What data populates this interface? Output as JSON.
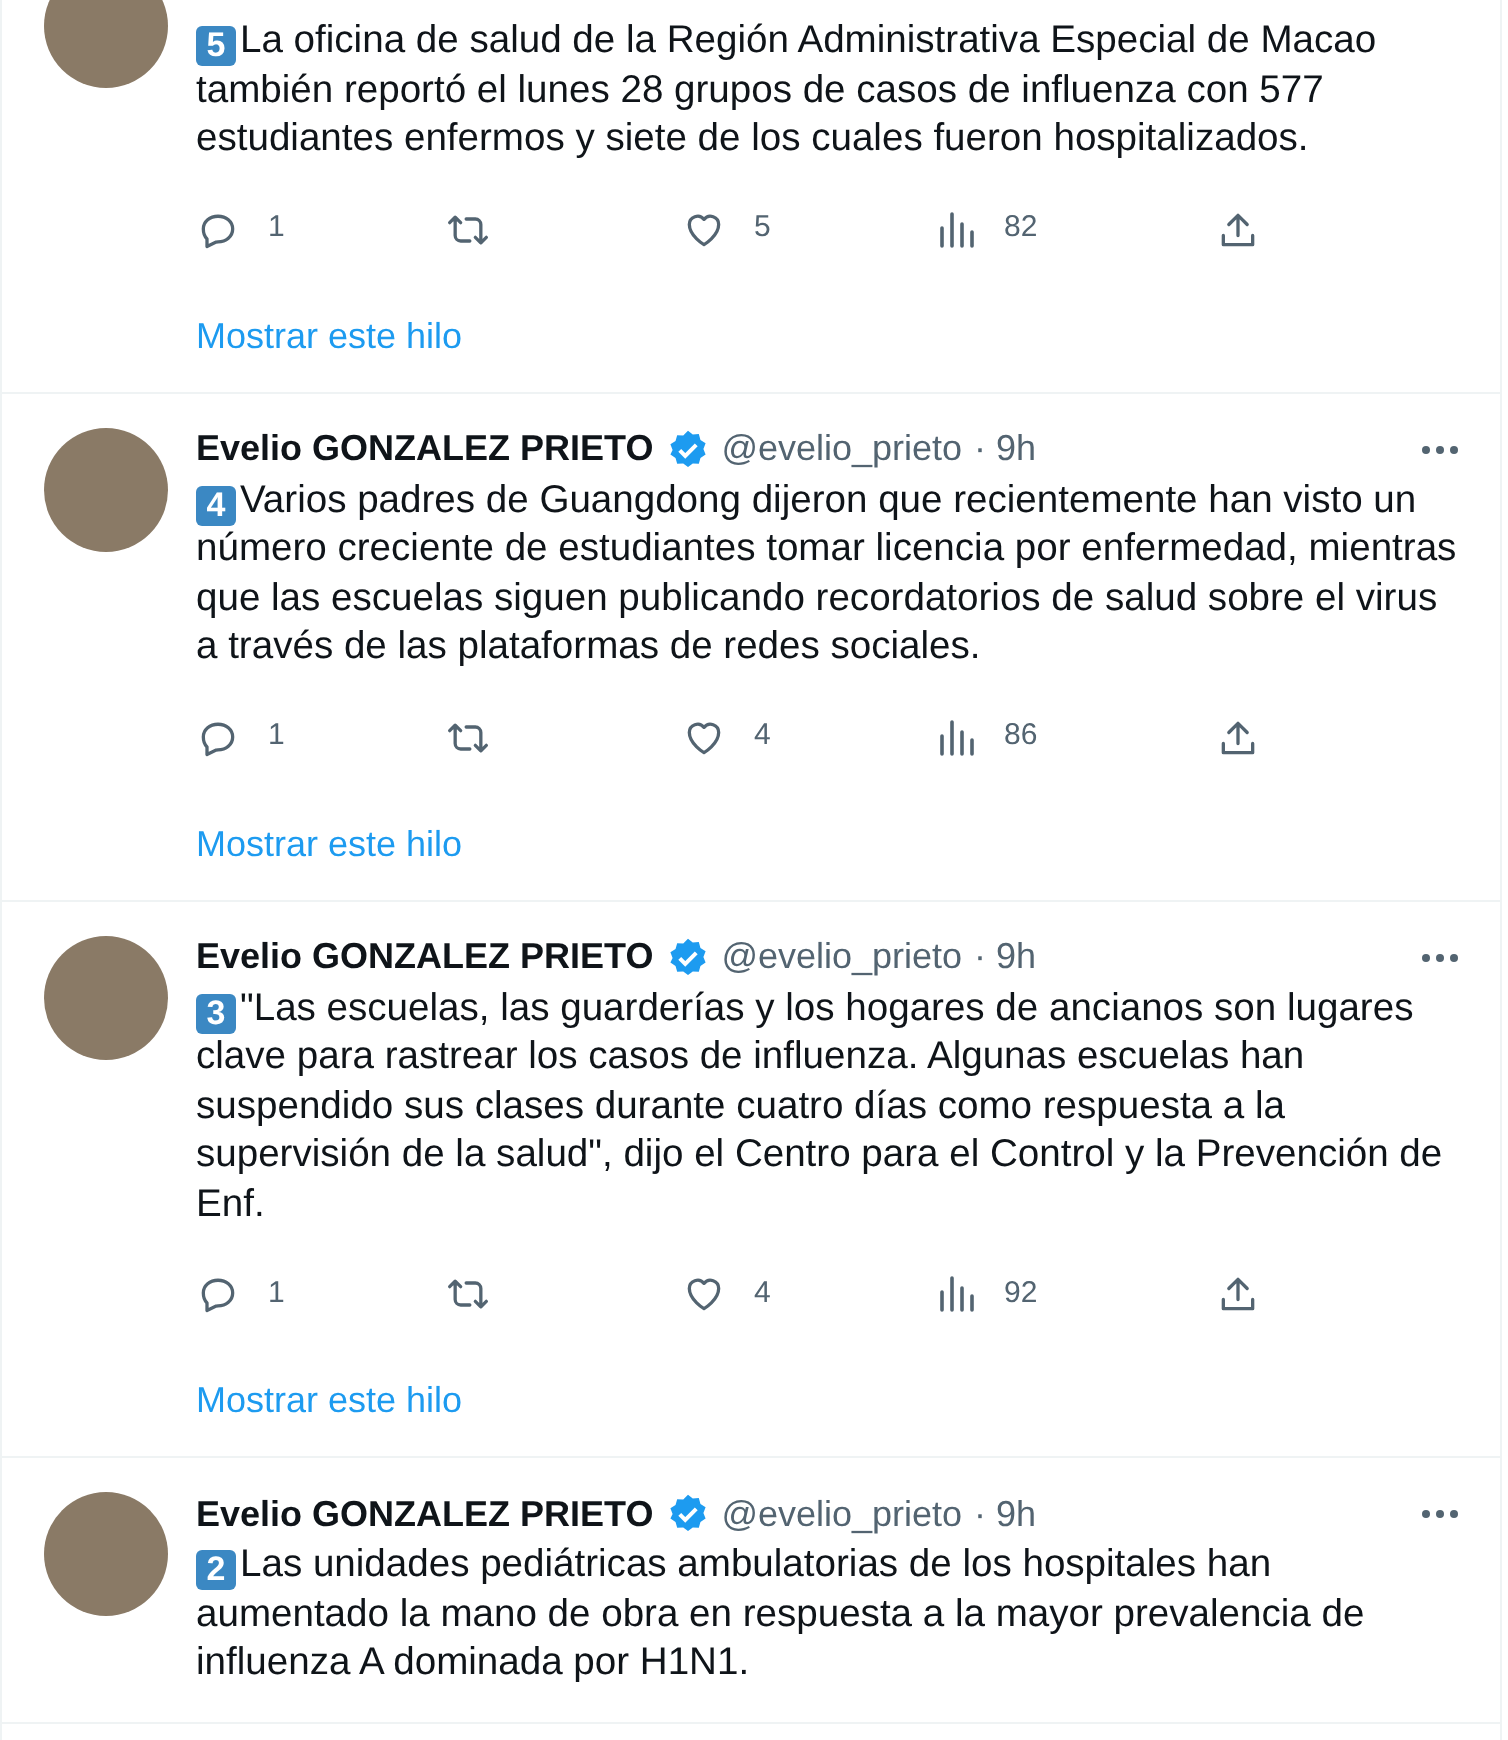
{
  "tweets": [
    {
      "number": "5",
      "text": "La oficina de salud de la Región Administrativa Especial de Macao también reportó el lunes 28 grupos de casos de influenza con 577 estudiantes enfermos y siete de los cuales fueron hospitalizados.",
      "replies": "1",
      "likes": "5",
      "views": "82",
      "show_thread": "Mostrar este hilo"
    },
    {
      "author": "Evelio GONZALEZ PRIETO",
      "verified": true,
      "handle": "@evelio_prieto",
      "time": "· 9h",
      "number": "4",
      "text": "Varios padres de Guangdong dijeron que recientemente han visto un número creciente de estudiantes tomar licencia por enfermedad, mientras que las escuelas siguen publicando recordatorios de salud sobre el virus a través de las plataformas de redes sociales.",
      "replies": "1",
      "likes": "4",
      "views": "86",
      "show_thread": "Mostrar este hilo"
    },
    {
      "author": "Evelio GONZALEZ PRIETO",
      "verified": true,
      "handle": "@evelio_prieto",
      "time": "· 9h",
      "number": "3",
      "text": "\"Las escuelas, las guarderías y los hogares de ancianos son lugares clave para rastrear los casos de influenza. Algunas escuelas han suspendido sus clases durante cuatro días como respuesta a la supervisión de la salud\", dijo el Centro para el Control y la Prevención de Enf.",
      "replies": "1",
      "likes": "4",
      "views": "92",
      "show_thread": "Mostrar este hilo"
    },
    {
      "author": "Evelio GONZALEZ PRIETO",
      "verified": true,
      "handle": "@evelio_prieto",
      "time": "· 9h",
      "number": "2",
      "text": "Las unidades pediátricas ambulatorias de los hospitales han aumentado la mano de obra en respuesta a la mayor prevalencia de influenza A dominada por H1N1."
    }
  ]
}
